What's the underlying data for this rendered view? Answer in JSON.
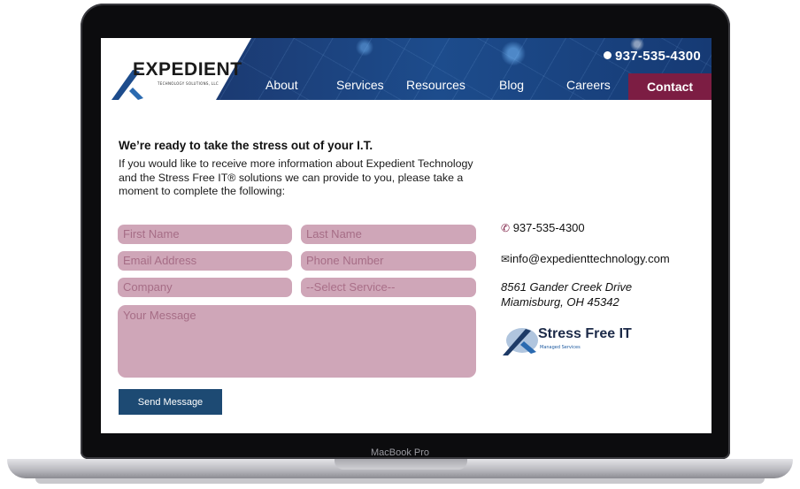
{
  "device": {
    "label": "MacBook Pro"
  },
  "header": {
    "logo_text": "EXPEDIENT",
    "logo_sub": "TECHNOLOGY SOLUTIONS, LLC",
    "phone": "937-535-4300",
    "nav": [
      "About",
      "Services",
      "Resources",
      "Blog",
      "Careers"
    ],
    "nav_active": "Contact"
  },
  "intro": {
    "title": "We’re ready to take the stress out of your I.T.",
    "body": "If you would like to receive more information about Expedient Technology and the Stress Free IT® solutions we can provide to you, please take a moment to complete the following:"
  },
  "form": {
    "first_name": "First Name",
    "last_name": "Last Name",
    "email": "Email Address",
    "phone": "Phone Number",
    "company": "Company",
    "service": "--Select Service--",
    "message": "Your Message",
    "submit": "Send Message"
  },
  "contact": {
    "phone": "937-535-4300",
    "email": "info@expedienttechnology.com",
    "address_line1": "8561 Gander Creek Drive",
    "address_line2": "Miamisburg, OH 45342"
  },
  "badge": {
    "title": "Stress Free IT",
    "sub": "Managed Services"
  },
  "colors": {
    "nav_blue": "#1d4c8c",
    "contact_maroon": "#7c1d43",
    "field_pink": "#cfa6b8",
    "button_blue": "#1d4a73"
  }
}
